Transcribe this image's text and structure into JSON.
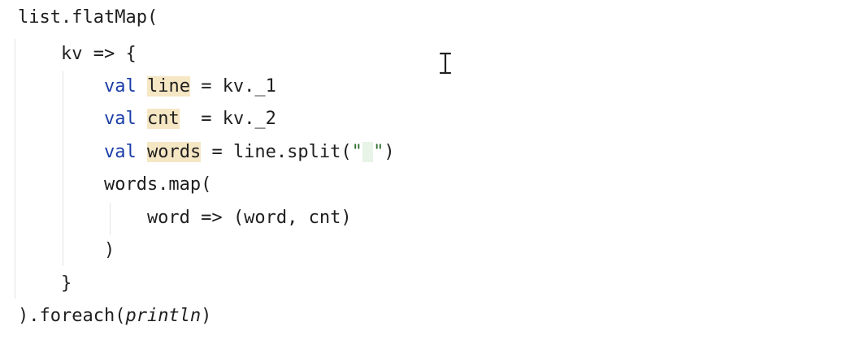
{
  "code": {
    "l1": {
      "text": "list.flatMap("
    },
    "l2": {
      "text": "    kv => {"
    },
    "l3": {
      "indent": "        ",
      "kw": "val",
      "sp": " ",
      "name": "line",
      "rest": " = kv._1"
    },
    "l4": {
      "indent": "        ",
      "kw": "val",
      "sp": " ",
      "name": "cnt",
      "rest": "  = kv._2"
    },
    "l5": {
      "indent": "        ",
      "kw": "val",
      "sp": " ",
      "name": "words",
      "rest": " = line.split(",
      "q1": "\"",
      "space": " ",
      "q2": "\"",
      "close": ")"
    },
    "l6": {
      "text": "        words.map("
    },
    "l7": {
      "text": "            word => (word, cnt)"
    },
    "l8": {
      "text": "        )"
    },
    "l9": {
      "text": "    }"
    },
    "l10": {
      "pre": ").foreach(",
      "fn": "println",
      "post": ")"
    }
  },
  "colors": {
    "keyword": "#1a3ea7",
    "highlight": "#f6e7c4",
    "string": "#2f6f2f",
    "text": "#1f1f1f"
  },
  "cursor_icon": "text-cursor-icon"
}
